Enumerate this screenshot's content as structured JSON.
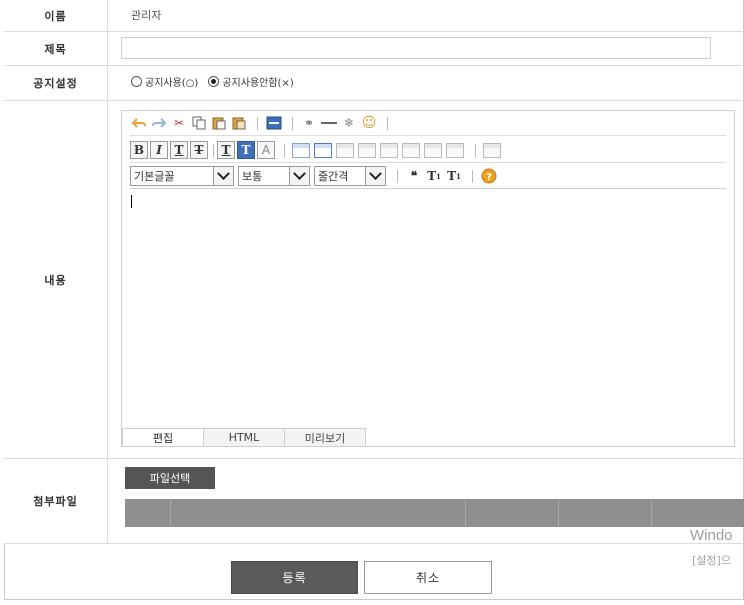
{
  "form": {
    "name": {
      "label": "이름",
      "value": "관리자"
    },
    "title": {
      "label": "제목",
      "value": ""
    },
    "notice": {
      "label": "공지설정",
      "options": [
        {
          "label": "공지사용(○)",
          "checked": false
        },
        {
          "label": "공지사용안함(×)",
          "checked": true
        }
      ]
    },
    "content": {
      "label": "내용"
    },
    "attachment": {
      "label": "첨부파일",
      "choose_button": "파일선택"
    }
  },
  "editor": {
    "selects": {
      "font": "기본글꼴",
      "size": "보통",
      "line_height": "줄간격"
    },
    "format_buttons": [
      "B",
      "I",
      "T",
      "T",
      "T",
      "T"
    ],
    "tabs": [
      "편집",
      "HTML",
      "미리보기"
    ],
    "active_tab": "편집"
  },
  "buttons": {
    "submit": "등록",
    "cancel": "취소"
  },
  "watermark": {
    "line1": "Windo",
    "line2": "[설정]으"
  }
}
